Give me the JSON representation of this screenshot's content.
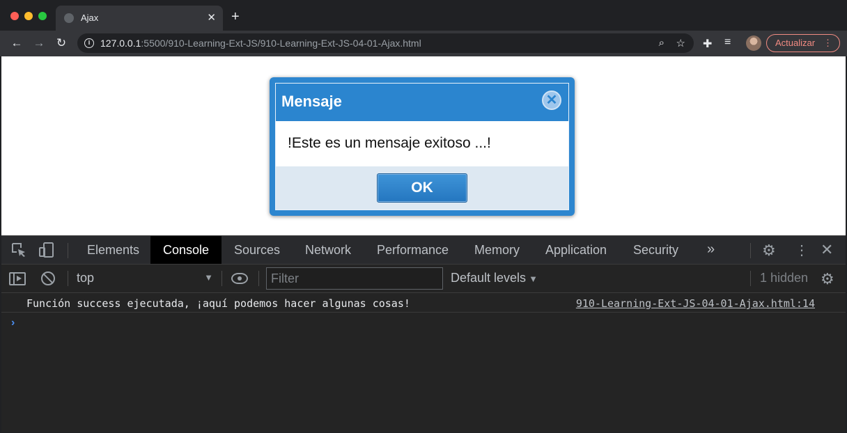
{
  "browser": {
    "tab": {
      "title": "Ajax",
      "close_icon": "close-icon"
    },
    "new_tab_label": "+",
    "url": {
      "host": "127.0.0.1",
      "rest": ":5500/910-Learning-Ext-JS/910-Learning-Ext-JS-04-01-Ajax.html"
    },
    "update_button": {
      "label": "Actualizar",
      "menu_glyph": "⋮"
    },
    "icons": {
      "back": "←",
      "forward": "→",
      "reload": "↻",
      "info": "i",
      "zoom": "⌕",
      "star": "☆",
      "extensions": "✚",
      "media": "≡"
    }
  },
  "dialog": {
    "title": "Mensaje",
    "message": "!Este es un mensaje exitoso ...!",
    "ok_label": "OK",
    "close_glyph": "✕"
  },
  "devtools": {
    "tabs": [
      "Elements",
      "Console",
      "Sources",
      "Network",
      "Performance",
      "Memory",
      "Application",
      "Security"
    ],
    "active_tab": "Console",
    "more_tabs_glyph": "»",
    "gear_glyph": "⚙",
    "kebab_glyph": "⋮",
    "close_glyph": "✕",
    "console": {
      "context": "top",
      "context_arrow": "▼",
      "filter_placeholder": "Filter",
      "levels_label": "Default levels",
      "levels_arrow": "▼",
      "hidden_label": "1 hidden",
      "prompt_glyph": "›",
      "messages": [
        {
          "text": "Función success ejecutada, ¡aquí podemos hacer algunas cosas!",
          "source": "910-Learning-Ext-JS-04-01-Ajax.html:14"
        }
      ]
    }
  },
  "colors": {
    "dialog_blue": "#2b85cf",
    "update_red": "#f28b82",
    "prompt_blue": "#4b8ef0"
  }
}
